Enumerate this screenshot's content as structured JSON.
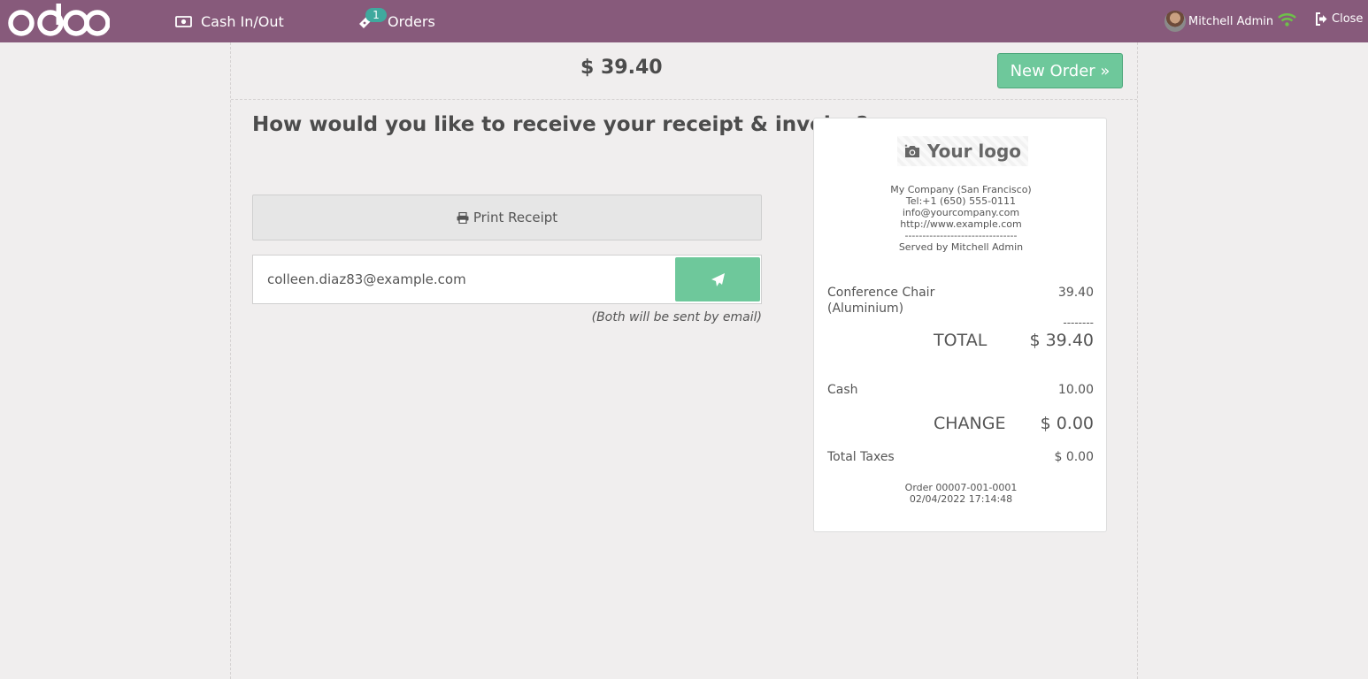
{
  "topbar": {
    "logo_text": "odoo",
    "cash_label": "Cash In/Out",
    "orders_label": "Orders",
    "orders_badge": "1",
    "user_name": "Mitchell Admin",
    "close_label": "Close"
  },
  "payment": {
    "total": "$ 39.40",
    "new_order_label": "New Order »",
    "question": "How would you like to receive your receipt & invoice?",
    "print_label": "Print Receipt",
    "email_value": "colleen.diaz83@example.com",
    "email_note": "(Both will be sent by email)"
  },
  "receipt": {
    "logo_label": "Your logo",
    "header_lines": [
      "My Company (San Francisco)",
      "Tel:+1 (650) 555-0111",
      "info@yourcompany.com",
      "http://www.example.com",
      "--------------------------------",
      "Served by Mitchell Admin"
    ],
    "line_name_1": "Conference Chair",
    "line_name_2": "(Aluminium)",
    "line_price": "39.40",
    "separator": "--------",
    "total_label": "TOTAL",
    "total_value": "$ 39.40",
    "cash_label": "Cash",
    "cash_value": "10.00",
    "change_label": "CHANGE",
    "change_value": "$ 0.00",
    "taxes_label": "Total Taxes",
    "taxes_value": "$ 0.00",
    "order_ref": "Order 00007-001-0001",
    "order_date": "02/04/2022 17:14:48"
  },
  "colors": {
    "topbar": "#875a7b",
    "accent_green": "#6ec89b",
    "badge": "#3fa99e",
    "background": "#f0eeee"
  }
}
